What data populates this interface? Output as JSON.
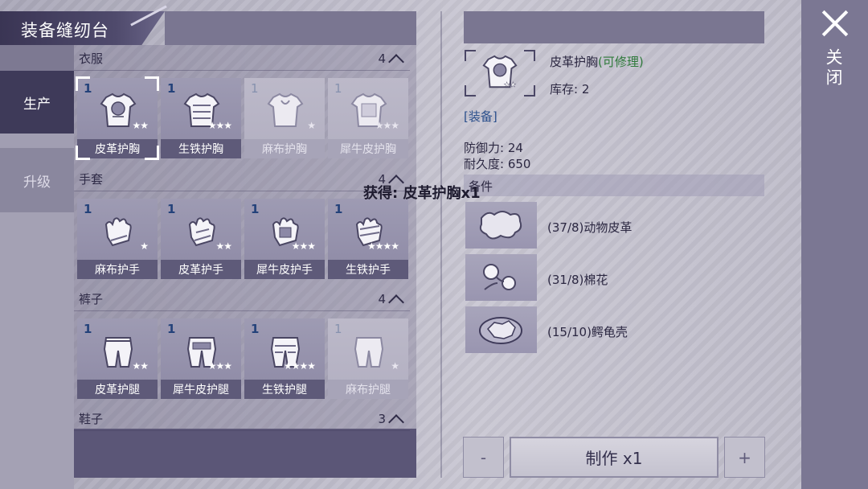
{
  "title": "装备缝纫台",
  "tabs": {
    "produce": "生产",
    "upgrade": "升级"
  },
  "categories": [
    {
      "name": "衣服",
      "count": "4"
    },
    {
      "name": "手套",
      "count": "4"
    },
    {
      "name": "裤子",
      "count": "4"
    },
    {
      "name": "鞋子",
      "count": "3"
    }
  ],
  "items": {
    "clothes": [
      {
        "count": "1",
        "stars": "★★",
        "label": "皮革护胸",
        "icon": "leather-chest-icon"
      },
      {
        "count": "1",
        "stars": "★★★",
        "label": "生铁护胸",
        "icon": "iron-chest-icon"
      },
      {
        "count": "1",
        "stars": "★",
        "label": "麻布护胸",
        "icon": "linen-chest-icon"
      },
      {
        "count": "1",
        "stars": "★★★",
        "label": "犀牛皮护胸",
        "icon": "rhino-chest-icon"
      }
    ],
    "gloves": [
      {
        "count": "1",
        "stars": "★",
        "label": "麻布护手",
        "icon": "linen-glove-icon"
      },
      {
        "count": "1",
        "stars": "★★",
        "label": "皮革护手",
        "icon": "leather-glove-icon"
      },
      {
        "count": "1",
        "stars": "★★★",
        "label": "犀牛皮护手",
        "icon": "rhino-glove-icon"
      },
      {
        "count": "1",
        "stars": "★★★★",
        "label": "生铁护手",
        "icon": "iron-glove-icon"
      }
    ],
    "pants": [
      {
        "count": "1",
        "stars": "★★",
        "label": "皮革护腿",
        "icon": "leather-leg-icon"
      },
      {
        "count": "1",
        "stars": "★★★",
        "label": "犀牛皮护腿",
        "icon": "rhino-leg-icon"
      },
      {
        "count": "1",
        "stars": "★★★★",
        "label": "生铁护腿",
        "icon": "iron-leg-icon"
      },
      {
        "count": "1",
        "stars": "★",
        "label": "麻布护腿",
        "icon": "linen-leg-icon"
      }
    ]
  },
  "detail": {
    "name": "皮革护胸",
    "repair": "(可修理)",
    "stock": "库存: 2",
    "tag": "[装备]",
    "defense": "防御力: 24",
    "durability": "耐久度: 650",
    "materials_header": "备件",
    "materials": [
      {
        "label": "(37/8)动物皮革",
        "icon": "animal-hide-icon"
      },
      {
        "label": "(31/8)棉花",
        "icon": "cotton-icon"
      },
      {
        "label": "(15/10)鳄龟壳",
        "icon": "turtle-shell-icon"
      }
    ]
  },
  "toast": "获得: 皮革护胸x1",
  "controls": {
    "minus": "-",
    "make": "制作 x1",
    "plus": "+"
  },
  "close": {
    "label": "关闭"
  }
}
